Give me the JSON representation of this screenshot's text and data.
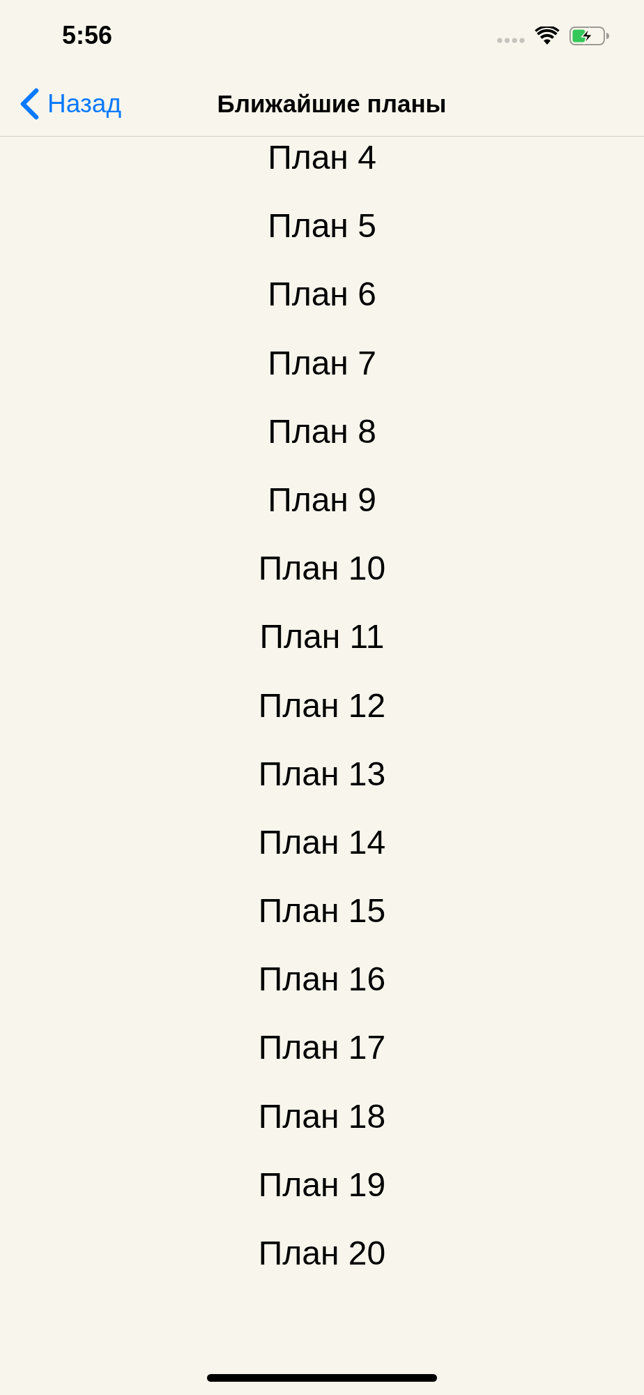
{
  "status_bar": {
    "time": "5:56"
  },
  "nav_bar": {
    "back_button": {
      "label": "Назад"
    },
    "title": "Ближайшие планы"
  },
  "plans": [
    "План 4",
    "План 5",
    "План 6",
    "План 7",
    "План 8",
    "План 9",
    "План 10",
    "План 11",
    "План 12",
    "План 13",
    "План 14",
    "План 15",
    "План 16",
    "План 17",
    "План 18",
    "План 19",
    "План 20"
  ]
}
